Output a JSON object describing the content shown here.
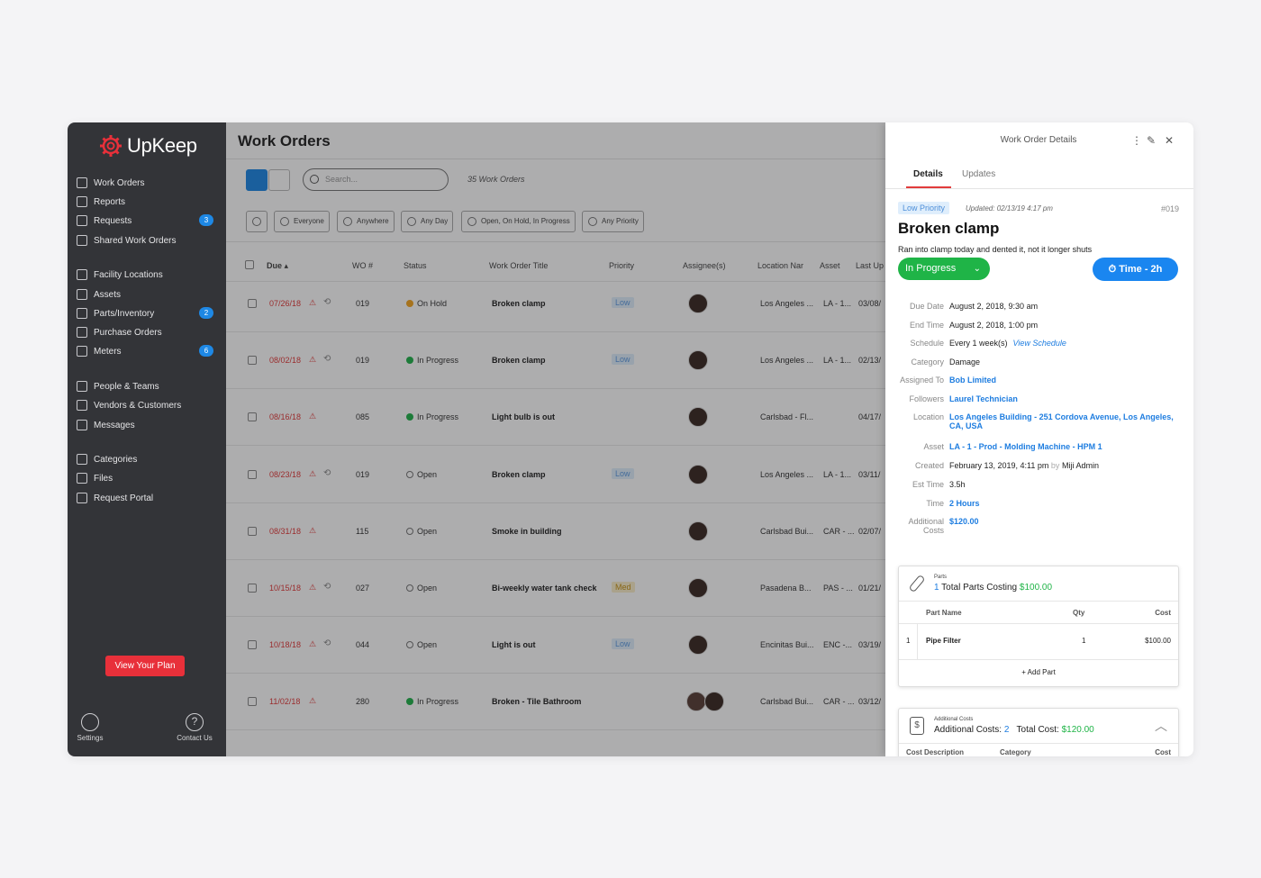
{
  "brand": {
    "name": "UpKeep",
    "accent": "#e8303a"
  },
  "sidebar": {
    "items": [
      {
        "label": "Work Orders",
        "icon": "clipboard-icon"
      },
      {
        "label": "Reports",
        "icon": "chart-icon"
      },
      {
        "label": "Requests",
        "icon": "inbox-icon",
        "badge": "3"
      },
      {
        "label": "Shared Work Orders",
        "icon": "share-icon"
      },
      {
        "label": "Facility Locations",
        "icon": "location-icon"
      },
      {
        "label": "Assets",
        "icon": "cube-icon"
      },
      {
        "label": "Parts/Inventory",
        "icon": "wrench-icon",
        "badge": "2"
      },
      {
        "label": "Purchase Orders",
        "icon": "document-icon"
      },
      {
        "label": "Meters",
        "icon": "gauge-icon",
        "badge": "6"
      },
      {
        "label": "People & Teams",
        "icon": "people-icon"
      },
      {
        "label": "Vendors & Customers",
        "icon": "vendor-icon"
      },
      {
        "label": "Messages",
        "icon": "chat-icon"
      },
      {
        "label": "Categories",
        "icon": "bookmark-icon"
      },
      {
        "label": "Files",
        "icon": "files-icon"
      },
      {
        "label": "Request Portal",
        "icon": "portal-icon"
      }
    ],
    "plan_button": "View Your Plan",
    "settings_label": "Settings",
    "contact_label": "Contact Us"
  },
  "main": {
    "title": "Work Orders",
    "search_placeholder": "Search...",
    "count_label": "35 Work Orders",
    "filters": [
      "Everyone",
      "Anywhere",
      "Any Day",
      "Open, On Hold, In Progress",
      "Any Priority"
    ],
    "columns": [
      "Due",
      "WO #",
      "Status",
      "Work Order Title",
      "Priority",
      "Assignee(s)",
      "Location Nar",
      "Asset",
      "Last Up"
    ],
    "rows": [
      {
        "due": "07/26/18",
        "wo": "019",
        "status": "On Hold",
        "status_kind": "hold",
        "title": "Broken clamp",
        "priority": "Low",
        "location": "Los Angeles ...",
        "asset": "LA - 1...",
        "last": "03/08/",
        "repeat": true,
        "avatars": 1
      },
      {
        "due": "08/02/18",
        "wo": "019",
        "status": "In Progress",
        "status_kind": "prog",
        "title": "Broken clamp",
        "priority": "Low",
        "location": "Los Angeles ...",
        "asset": "LA - 1...",
        "last": "02/13/",
        "repeat": true,
        "avatars": 1
      },
      {
        "due": "08/16/18",
        "wo": "085",
        "status": "In Progress",
        "status_kind": "prog",
        "title": "Light bulb is out",
        "priority": "",
        "location": "Carlsbad - Fl...",
        "asset": "",
        "last": "04/17/",
        "repeat": false,
        "avatars": 1
      },
      {
        "due": "08/23/18",
        "wo": "019",
        "status": "Open",
        "status_kind": "open",
        "title": "Broken clamp",
        "priority": "Low",
        "location": "Los Angeles ...",
        "asset": "LA - 1...",
        "last": "03/11/",
        "repeat": true,
        "avatars": 1
      },
      {
        "due": "08/31/18",
        "wo": "115",
        "status": "Open",
        "status_kind": "open",
        "title": "Smoke in building",
        "priority": "",
        "location": "Carlsbad Bui...",
        "asset": "CAR - ...",
        "last": "02/07/",
        "repeat": false,
        "avatars": 1
      },
      {
        "due": "10/15/18",
        "wo": "027",
        "status": "Open",
        "status_kind": "open",
        "title": "Bi-weekly water tank check",
        "priority": "Med",
        "location": "Pasadena B...",
        "asset": "PAS - ...",
        "last": "01/21/",
        "repeat": true,
        "avatars": 1
      },
      {
        "due": "10/18/18",
        "wo": "044",
        "status": "Open",
        "status_kind": "open",
        "title": "Light is out",
        "priority": "Low",
        "location": "Encinitas Bui...",
        "asset": "ENC -...",
        "last": "03/19/",
        "repeat": true,
        "avatars": 1
      },
      {
        "due": "11/02/18",
        "wo": "280",
        "status": "In Progress",
        "status_kind": "prog",
        "title": "Broken - Tile Bathroom",
        "priority": "",
        "location": "Carlsbad Bui...",
        "asset": "CAR - ...",
        "last": "03/12/",
        "repeat": false,
        "avatars": 2
      }
    ]
  },
  "panel": {
    "title": "Work Order Details",
    "tabs": [
      "Details",
      "Updates"
    ],
    "priority_badge": "Low Priority",
    "updated_label": "Updated:",
    "updated_value": "02/13/19 4:17 pm",
    "wo_number": "#019",
    "wo_title": "Broken clamp",
    "description": "Ran into clamp today and dented it, not it longer shuts",
    "status": "In Progress",
    "time_button": "Time - 2h",
    "details": [
      {
        "label": "Due Date",
        "value": "August 2, 2018, 9:30 am"
      },
      {
        "label": "End Time",
        "value": "August 2, 2018, 1:00 pm"
      },
      {
        "label": "Schedule",
        "value": "Every 1 week(s)",
        "extra": "View Schedule"
      },
      {
        "label": "Category",
        "value": "Damage"
      },
      {
        "label": "Assigned To",
        "value": "Bob Limited",
        "link": true
      },
      {
        "label": "Followers",
        "value": "Laurel Technician",
        "link": true
      },
      {
        "label": "Location",
        "value": "Los Angeles Building - 251 Cordova Avenue, Los Angeles,",
        "value2": "CA, USA",
        "link": true
      },
      {
        "label": "Asset",
        "value": "LA - 1 - Prod - Molding Machine - HPM 1",
        "link": true
      },
      {
        "label": "Created",
        "value": "February 13, 2019, 4:11 pm",
        "by": "by",
        "who": "Miji Admin"
      },
      {
        "label": "Est Time",
        "value": "3.5h"
      },
      {
        "label": "Time",
        "value": "2 Hours",
        "link": true
      },
      {
        "label": "Additional",
        "label2": "Costs",
        "value": "$120.00",
        "link": true
      }
    ],
    "parts": {
      "small_label": "Parts",
      "count": "1",
      "text": "Total Parts Costing",
      "total": "$100.00",
      "headers": [
        "Part Name",
        "Qty",
        "Cost"
      ],
      "rows": [
        {
          "n": "1",
          "name": "Pipe Filter",
          "qty": "1",
          "cost": "$100.00"
        }
      ],
      "add": "+ Add Part"
    },
    "costs": {
      "small_label": "Additional Costs",
      "text": "Additional Costs:",
      "count": "2",
      "total_label": "Total Cost:",
      "total": "$120.00",
      "headers": [
        "Cost Description",
        "Category",
        "Cost"
      ]
    }
  }
}
